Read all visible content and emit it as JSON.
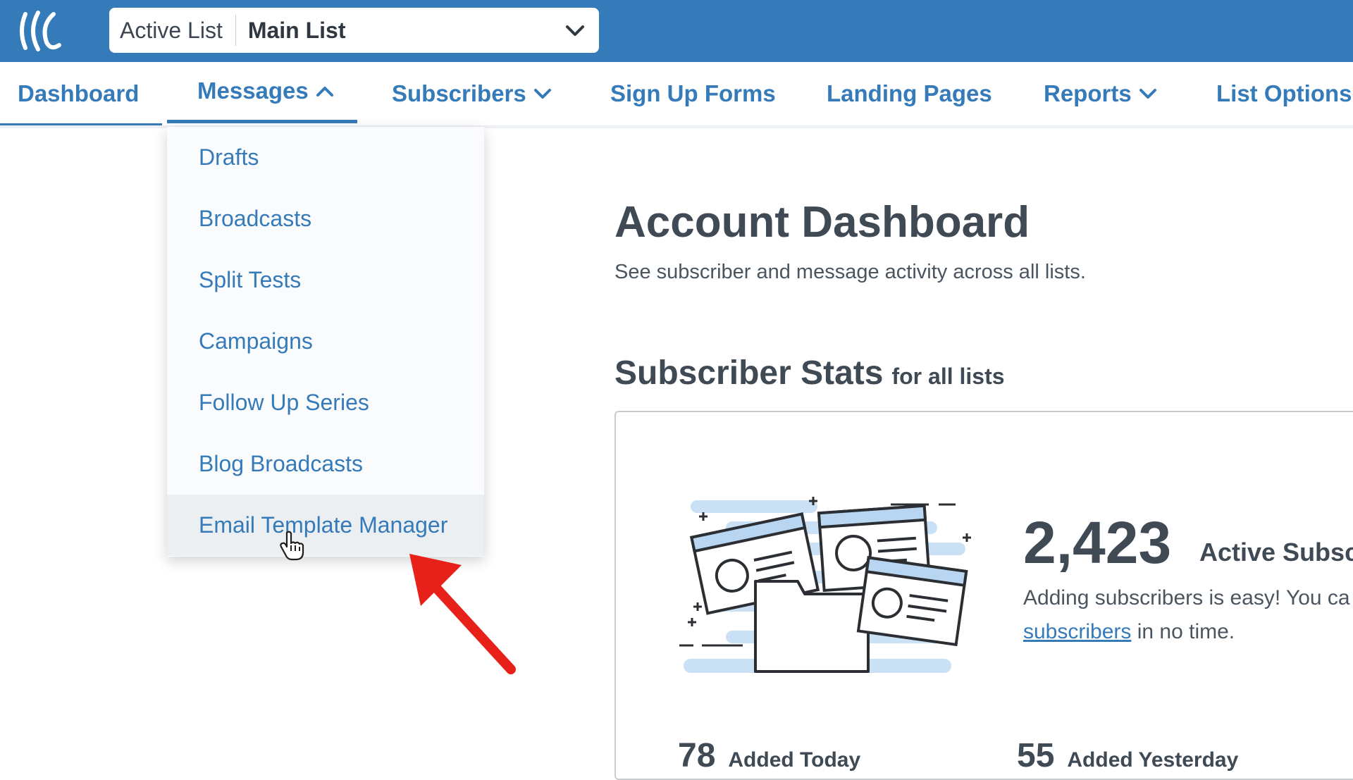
{
  "colors": {
    "brand": "#357ab9",
    "text_dark": "#3f4a55",
    "arrow": "#e8201a"
  },
  "list_selector": {
    "label": "Active List",
    "value": "Main List"
  },
  "nav": {
    "items": [
      {
        "label": "Dashboard"
      },
      {
        "label": "Messages"
      },
      {
        "label": "Subscribers"
      },
      {
        "label": "Sign Up Forms"
      },
      {
        "label": "Landing Pages"
      },
      {
        "label": "Reports"
      },
      {
        "label": "List Options"
      }
    ]
  },
  "messages_menu": {
    "items": [
      {
        "label": "Drafts"
      },
      {
        "label": "Broadcasts"
      },
      {
        "label": "Split Tests"
      },
      {
        "label": "Campaigns"
      },
      {
        "label": "Follow Up Series"
      },
      {
        "label": "Blog Broadcasts"
      },
      {
        "label": "Email Template Manager"
      }
    ]
  },
  "main": {
    "title": "Account Dashboard",
    "subtitle": "See subscriber and message activity across all lists.",
    "stats_title": "Subscriber Stats",
    "stats_subtitle": "for all lists",
    "active_count": "2,423",
    "active_label": "Active Subsc",
    "desc_line1": "Adding subscribers is easy! You ca",
    "desc_link": "subscribers",
    "desc_line2_rest": "in no time.",
    "added_today_value": "78",
    "added_today_label": "Added Today",
    "added_yesterday_value": "55",
    "added_yesterday_label": "Added Yesterday"
  }
}
